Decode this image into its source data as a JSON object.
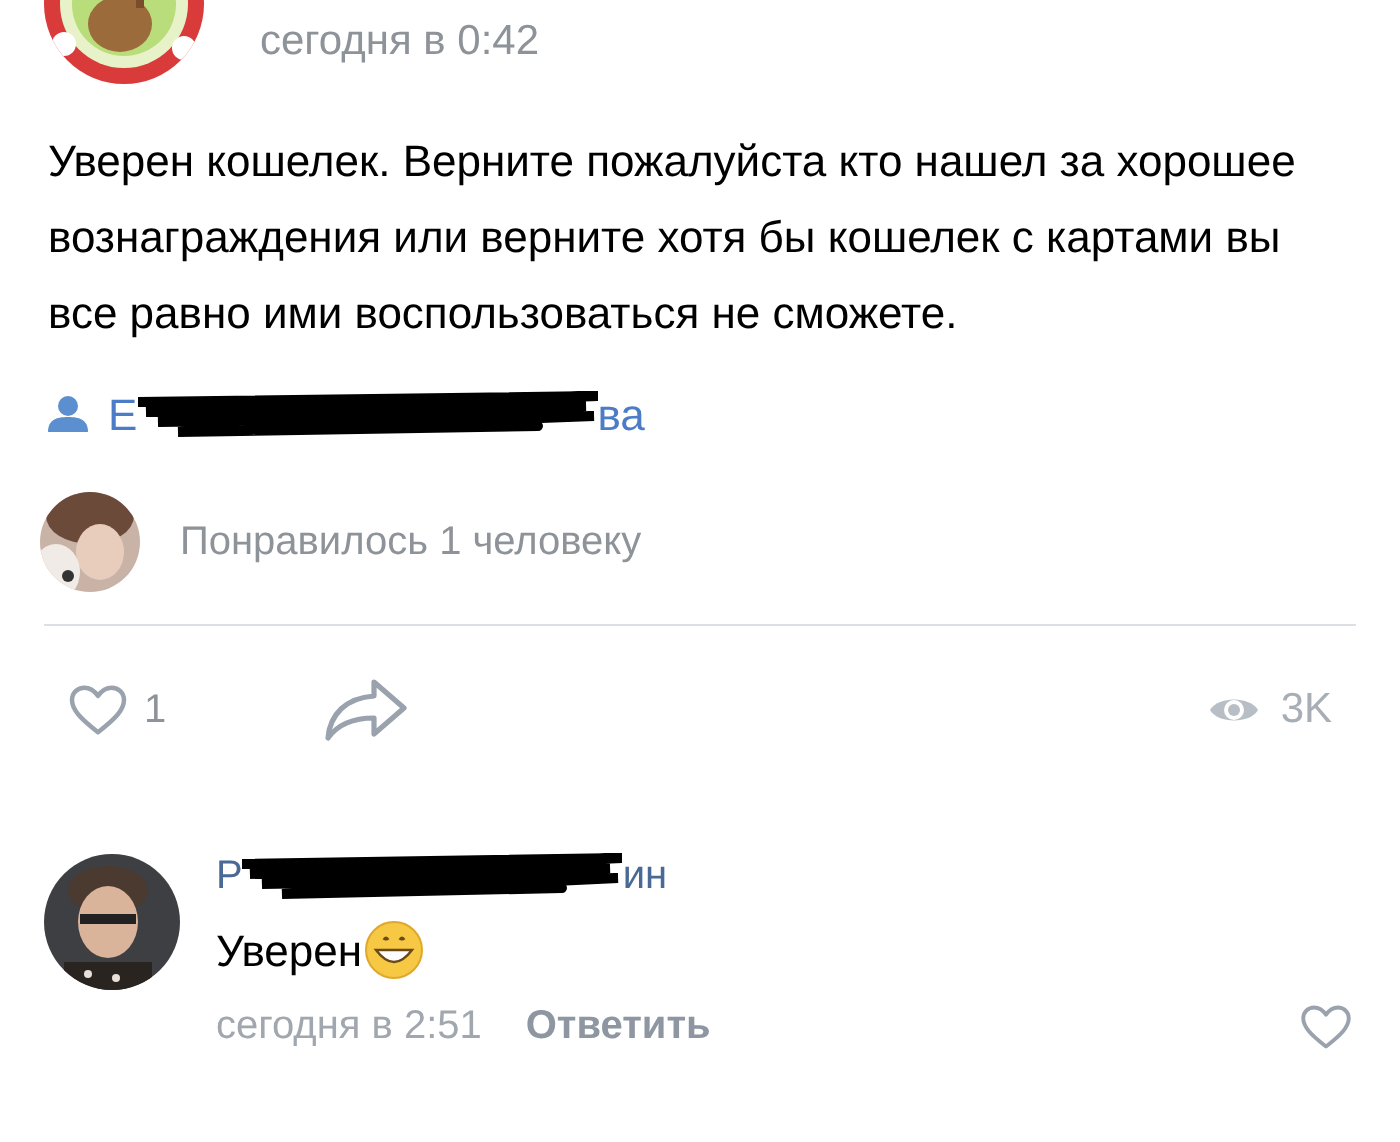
{
  "post": {
    "time": "сегодня в 0:42",
    "text": "Уверен кошелек. Верните пожалуйста кто нашел за хорошее вознаграждения или верните хотя бы кошелек с картами вы все равно ими воспользоваться не сможете.",
    "author_fragments": [
      "Е",
      "ва"
    ]
  },
  "likes_summary": "Понравилось 1 человеку",
  "actions": {
    "liked": false,
    "like_count": "1",
    "views": "3K"
  },
  "comment": {
    "name_fragments": [
      "Р",
      "ин"
    ],
    "text": "Уверен",
    "time": "сегодня в 2:51",
    "reply": "Ответить",
    "liked": false
  }
}
